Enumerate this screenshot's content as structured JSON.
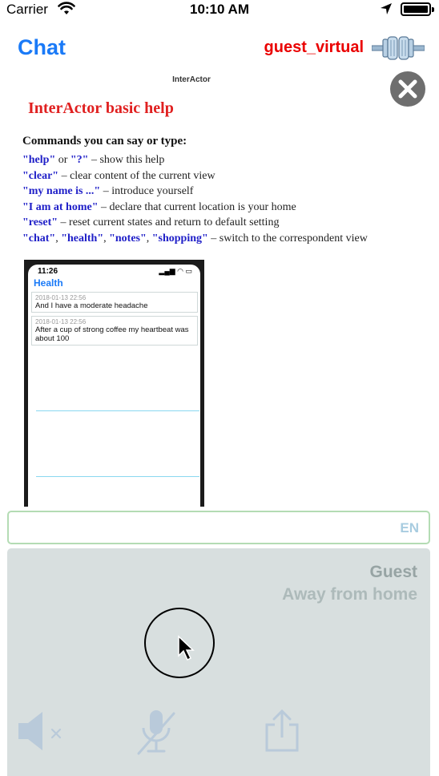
{
  "status_bar": {
    "carrier": "Carrier",
    "time": "10:10 AM"
  },
  "nav": {
    "title": "Chat",
    "user": "guest_virtual"
  },
  "help": {
    "app_name": "InterActor",
    "title": "InterActor basic help",
    "subtitle": "Commands you can say or type:",
    "commands": [
      {
        "parts": [
          {
            "t": "\"help\"",
            "kw": true
          },
          {
            "t": " or ",
            "kw": false
          },
          {
            "t": "\"?\"",
            "kw": true
          },
          {
            "t": " – show this help",
            "kw": false
          }
        ]
      },
      {
        "parts": [
          {
            "t": "\"clear\"",
            "kw": true
          },
          {
            "t": " – clear content of the current view",
            "kw": false
          }
        ]
      },
      {
        "parts": [
          {
            "t": "\"my name is ...\"",
            "kw": true
          },
          {
            "t": " – introduce yourself",
            "kw": false
          }
        ]
      },
      {
        "parts": [
          {
            "t": "\"I am at home\"",
            "kw": true
          },
          {
            "t": " – declare that current location is your home",
            "kw": false
          }
        ]
      },
      {
        "parts": [
          {
            "t": "\"reset\"",
            "kw": true
          },
          {
            "t": " – reset current states and return to default setting",
            "kw": false
          }
        ]
      },
      {
        "parts": [
          {
            "t": "\"chat\"",
            "kw": true
          },
          {
            "t": ", ",
            "kw": false
          },
          {
            "t": "\"health\"",
            "kw": true
          },
          {
            "t": ", ",
            "kw": false
          },
          {
            "t": "\"notes\"",
            "kw": true
          },
          {
            "t": ", ",
            "kw": false
          },
          {
            "t": "\"shopping\"",
            "kw": true
          },
          {
            "t": " – switch to the correspondent view",
            "kw": false
          }
        ]
      }
    ],
    "keyword_color": "#2020c8",
    "title_color": "#e02020"
  },
  "phone_preview": {
    "time": "11:26",
    "title": "Health",
    "messages": [
      {
        "timestamp": "2018-01-13 22:56",
        "text": "And I have a moderate headache"
      },
      {
        "timestamp": "2018-01-13 22:56",
        "text": "After a cup of strong coffee my heartbeat was about  100"
      }
    ]
  },
  "input": {
    "value": "",
    "placeholder": "",
    "language": "EN"
  },
  "guest": {
    "name": "Guest",
    "location": "Away from home"
  },
  "colors": {
    "accent": "#1a7af7",
    "user": "#ea0000",
    "panel": "#d8dfdf"
  },
  "icons": {
    "close": "close-icon",
    "plug": "plug-icon",
    "mute": "speaker-muted-icon",
    "mic": "microphone-off-icon",
    "share": "share-icon"
  }
}
